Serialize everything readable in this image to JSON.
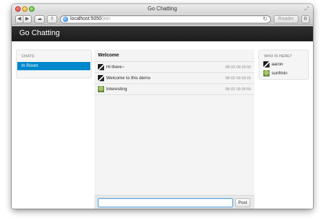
{
  "window": {
    "title": "Go Chatting"
  },
  "toolbar": {
    "back_icon": "back-arrow",
    "back_glyph": "◀",
    "forward_icon": "forward-arrow",
    "forward_glyph": "▶",
    "cloud_icon": "cloud-icon",
    "cloud_glyph": "☁",
    "share_icon": "share-icon",
    "share_glyph": "⇪",
    "url_host": "localhost:5050",
    "url_path": "/join",
    "reload_glyph": "↻",
    "reader_label": "Reader",
    "gear_glyph": "⚙"
  },
  "app": {
    "brand": "Go Chatting"
  },
  "sidebar": {
    "header": "CHATS",
    "rooms": [
      {
        "label": "In Room",
        "active": true
      }
    ]
  },
  "chat": {
    "title": "Welcome",
    "messages": [
      {
        "text": "Hi there~",
        "time": "08-02 09:18:02",
        "avatar": "avatar-a"
      },
      {
        "text": "Welcome to this demo",
        "time": "08-02 09:18:15",
        "avatar": "avatar-a"
      },
      {
        "text": "Interesting",
        "time": "08-02 09:18:50",
        "avatar": "avatar-b"
      }
    ],
    "input_value": "",
    "post_label": "Post"
  },
  "users_panel": {
    "header": "WHO IS HERE?",
    "users": [
      {
        "name": "aaron",
        "avatar": "avatar-a"
      },
      {
        "name": "sunfmin",
        "avatar": "avatar-b"
      }
    ]
  },
  "colors": {
    "navbar": "#222222",
    "active_room": "#0088cc",
    "input_focus": "#5fa6dd"
  }
}
